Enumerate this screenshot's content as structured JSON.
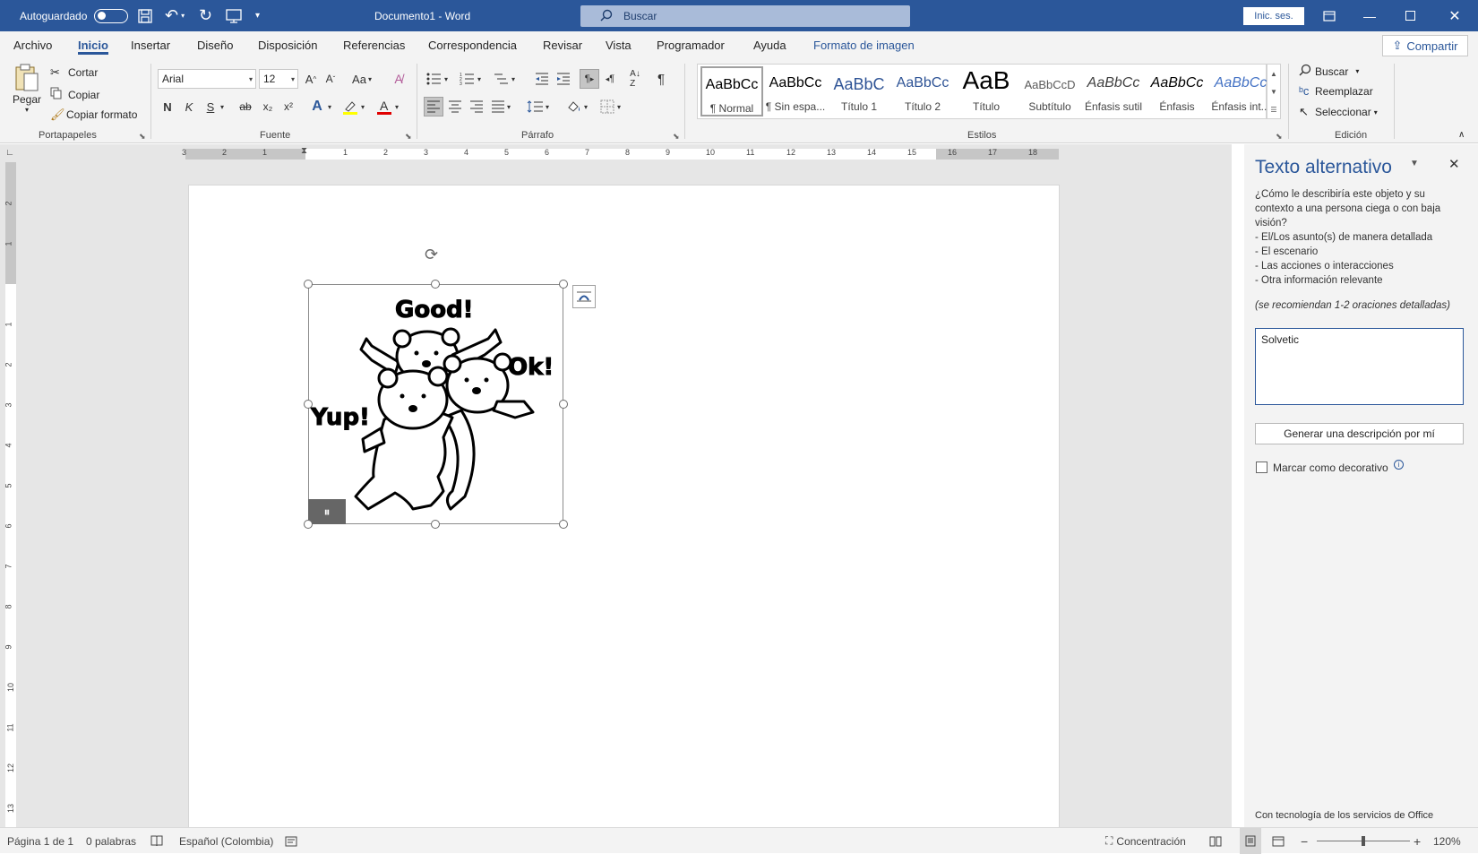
{
  "titlebar": {
    "autosave_label": "Autoguardado",
    "document_title": "Documento1 - Word",
    "search_placeholder": "Buscar",
    "signin_label": "Inic. ses."
  },
  "menu": {
    "tabs": [
      "Archivo",
      "Inicio",
      "Insertar",
      "Diseño",
      "Disposición",
      "Referencias",
      "Correspondencia",
      "Revisar",
      "Vista",
      "Programador",
      "Ayuda",
      "Formato de imagen"
    ],
    "active_tab": "Inicio",
    "share_label": "Compartir"
  },
  "ribbon": {
    "clipboard": {
      "paste": "Pegar",
      "cut": "Cortar",
      "copy": "Copiar",
      "format_painter": "Copiar formato",
      "label": "Portapapeles"
    },
    "font": {
      "name": "Arial",
      "size": "12",
      "case_btn": "Aa",
      "bold": "N",
      "italic": "K",
      "underline": "S",
      "strike": "ab",
      "sub": "x₂",
      "sup": "x²",
      "label": "Fuente"
    },
    "paragraph": {
      "label": "Párrafo"
    },
    "styles": {
      "items": [
        {
          "preview": "AaBbCc",
          "name": "¶ Normal"
        },
        {
          "preview": "AaBbCc",
          "name": "¶ Sin espa..."
        },
        {
          "preview": "AaBbC",
          "name": "Título 1"
        },
        {
          "preview": "AaBbCc",
          "name": "Título 2"
        },
        {
          "preview": "AaB",
          "name": "Título"
        },
        {
          "preview": "AaBbCcD",
          "name": "Subtítulo"
        },
        {
          "preview": "AaBbCc",
          "name": "Énfasis sutil"
        },
        {
          "preview": "AaBbCc",
          "name": "Énfasis"
        },
        {
          "preview": "AaBbCc",
          "name": "Énfasis int..."
        }
      ],
      "label": "Estilos"
    },
    "editing": {
      "find": "Buscar",
      "replace": "Reemplazar",
      "select": "Seleccionar",
      "label": "Edición"
    }
  },
  "ruler": {
    "h_labels": [
      "3",
      "2",
      "1",
      "1",
      "2",
      "3",
      "4",
      "5",
      "6",
      "7",
      "8",
      "9",
      "10",
      "11",
      "12",
      "13",
      "14",
      "15",
      "16",
      "17",
      "18"
    ],
    "v_labels": [
      "2",
      "1",
      "1",
      "2",
      "3",
      "4",
      "5",
      "6",
      "7",
      "8",
      "9",
      "10",
      "11",
      "12",
      "13"
    ]
  },
  "image": {
    "texts": {
      "good": "Good!",
      "ok": "Ok!",
      "yup": "Yup!"
    }
  },
  "alt_text_pane": {
    "title": "Texto alternativo",
    "question": "¿Cómo le describiría este objeto y su contexto a una persona ciega o con baja visión?",
    "bullets": [
      "- El/Los asunto(s) de manera detallada",
      "- El escenario",
      "- Las acciones o interacciones",
      "- Otra información relevante"
    ],
    "recommendation": "(se recomiendan 1-2 oraciones detalladas)",
    "input_value": "Solvetic",
    "generate_button": "Generar una descripción por mí",
    "decorative_label": "Marcar como decorativo",
    "footer": "Con tecnología de los servicios de Office"
  },
  "statusbar": {
    "page": "Página 1 de 1",
    "words": "0 palabras",
    "language": "Español (Colombia)",
    "focus": "Concentración",
    "zoom": "120%"
  },
  "colors": {
    "brand": "#2b579a",
    "ribbon_bg": "#f3f3f3",
    "workspace_bg": "#e6e6e6"
  }
}
